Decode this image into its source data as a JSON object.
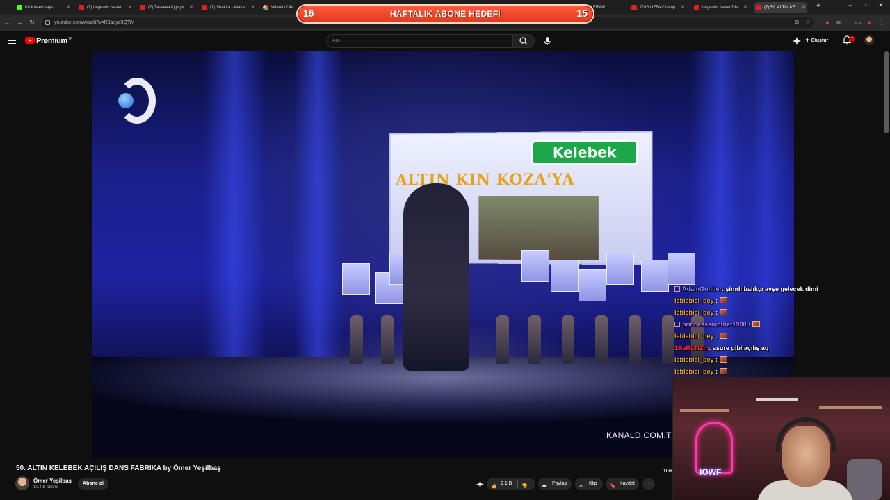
{
  "browser": {
    "tabs": [
      {
        "label": "Kick team says...",
        "icon": "kick-icon"
      },
      {
        "label": "(7) Legends Never",
        "icon": "youtube-icon"
      },
      {
        "label": "(7) Татьяна Куртук",
        "icon": "youtube-icon"
      },
      {
        "label": "(7) Shakira - Waka",
        "icon": "youtube-icon"
      },
      {
        "label": "Wheel of Names",
        "icon": "wheel-icon"
      },
      {
        "label": "(7) FIFA World Cu",
        "icon": "youtube-icon"
      },
      {
        "label": "2013 UEFA Champ",
        "icon": "youtube-icon"
      },
      {
        "label": "Legends Never Die",
        "icon": "youtube-icon"
      },
      {
        "label": "(7) 50. ALTIN KE",
        "icon": "youtube-icon"
      }
    ],
    "url": "youtube.com/watch?v=R3suyq9QTiY"
  },
  "goal_overlay": {
    "left_count": "16",
    "title": "HAFTALIK ABONE HEDEFİ",
    "right_count": "15"
  },
  "youtube": {
    "brand": "Premium",
    "brand_region": "TR",
    "search_placeholder": "Ara",
    "create_label": "Oluştur",
    "notification_count": "7"
  },
  "video": {
    "board_title": "Kelebek",
    "board_headline": "ALTIN  KIN KOZA'YA",
    "watermark": "KANALD.COM.TR"
  },
  "chat": {
    "messages": [
      {
        "user": "AdamGontier",
        "user_color": "#8a8aff",
        "text": ": şimdi balıkçı ayşe gelecek dimi",
        "badge": true,
        "emote": false
      },
      {
        "user": "leblebici_bey",
        "user_color": "#f5a623",
        "text": " :",
        "badge": false,
        "emote": true
      },
      {
        "user": "leblebici_bey",
        "user_color": "#f5a623",
        "text": " :",
        "badge": false,
        "emote": true
      },
      {
        "user": "princesssmother1990",
        "user_color": "#b070ff",
        "text": " :",
        "badge": true,
        "emote": true
      },
      {
        "user": "leblebici_bey",
        "user_color": "#f5a623",
        "text": " :",
        "badge": false,
        "emote": true
      },
      {
        "user": "1BeRaTiZm",
        "user_color": "#ff2a2a",
        "text": ": aşure gibi açılış aq",
        "badge": false,
        "emote": false
      },
      {
        "user": "leblebici_bey",
        "user_color": "#f5a623",
        "text": " :",
        "badge": false,
        "emote": true
      },
      {
        "user": "leblebici_bey",
        "user_color": "#f5a623",
        "text": " :",
        "badge": false,
        "emote": true
      }
    ]
  },
  "webcam": {
    "neon_text": "IOWF"
  },
  "video_info": {
    "title": "50. ALTIN KELEBEK AÇILIŞ DANS FABRIKA by Ömer Yeşilbaş",
    "channel": "Ömer Yeşilbaş",
    "subscribers": "10,4 B abone",
    "subscribe_label": "Abone ol",
    "likes": "2,1 B",
    "share_label": "Paylaş",
    "clip_label": "Klip",
    "save_label": "Kaydet",
    "side_tag": "Tüm"
  }
}
